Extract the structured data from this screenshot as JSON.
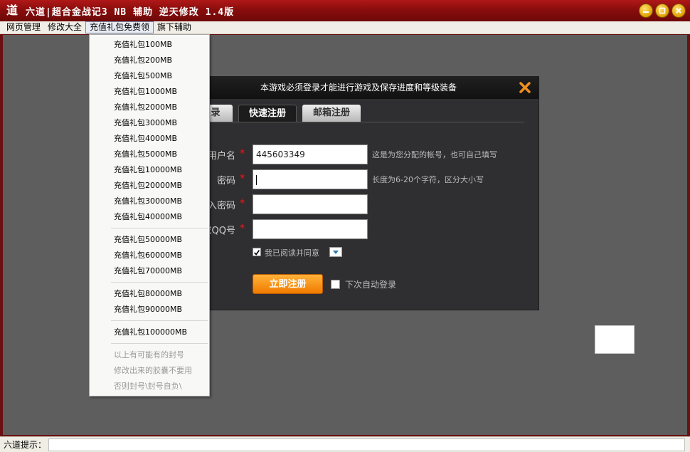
{
  "window": {
    "title": "六道|超合金战记3 NB 辅助 逆天修改 1.4版",
    "icon_char": "道"
  },
  "menu": [
    "网页管理",
    "修改大全",
    "充值礼包免费领",
    "旗下辅助"
  ],
  "dropdown": {
    "groups": [
      [
        "充值礼包100MB",
        "充值礼包200MB",
        "充值礼包500MB",
        "充值礼包1000MB",
        "充值礼包2000MB",
        "充值礼包3000MB",
        "充值礼包4000MB",
        "充值礼包5000MB",
        "充值礼包10000MB",
        "充值礼包20000MB",
        "充值礼包30000MB",
        "充值礼包40000MB"
      ],
      [
        "充值礼包50000MB",
        "充值礼包60000MB",
        "充值礼包70000MB"
      ],
      [
        "充值礼包80000MB",
        "充值礼包90000MB"
      ],
      [
        "充值礼包100000MB"
      ]
    ],
    "notes": [
      "以上有可能有的封号",
      "修改出来的胶囊不要用",
      "否则封号\\封号自负\\"
    ]
  },
  "dialog": {
    "title": "本游戏必须登录才能进行游戏及保存进度和等级装备",
    "tabs": [
      "录",
      "快速注册",
      "邮箱注册"
    ],
    "fields": {
      "username_label": "用户名",
      "username_value": "445603349",
      "username_hint": "这是为您分配的帐号，也可自己填写",
      "password_label": "密码",
      "password_hint": "长度为6-20个字符，区分大小写",
      "confirm_label": "入密码",
      "qq_label": "或QQ号"
    },
    "agree_text": "我已阅读并同意",
    "register_button": "立即注册",
    "auto_login": "下次自动登录"
  },
  "status": {
    "label": "六道提示："
  }
}
